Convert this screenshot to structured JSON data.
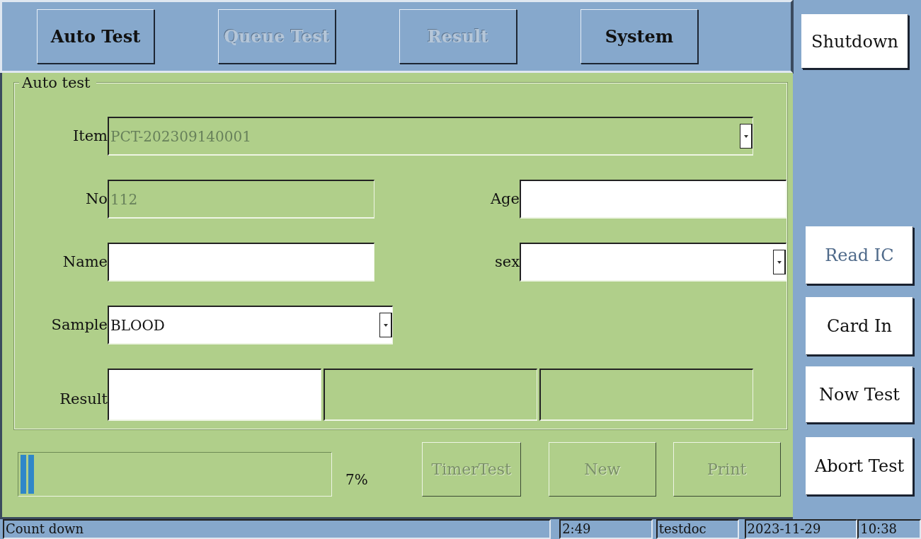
{
  "tabs": [
    {
      "label": "Auto Test",
      "disabled": false
    },
    {
      "label": "Queue Test",
      "disabled": true
    },
    {
      "label": "Result",
      "disabled": true
    },
    {
      "label": "System",
      "disabled": false
    }
  ],
  "side_buttons": [
    {
      "label": "Shutdown",
      "disabled": false
    },
    {
      "label": "Read IC",
      "disabled": true
    },
    {
      "label": "Card In",
      "disabled": false
    },
    {
      "label": "Now Test",
      "disabled": false
    },
    {
      "label": "Abort Test",
      "disabled": false
    }
  ],
  "group_title": "Auto test",
  "form_rows": [
    [
      {
        "label": "Item",
        "kind": "dropdown",
        "value": "PCT-202309140001",
        "disabled": true
      }
    ],
    [
      {
        "label": "No",
        "kind": "text",
        "value": "112",
        "disabled": true
      },
      {
        "label": "Age",
        "kind": "text",
        "disabled": false
      }
    ],
    [
      {
        "label": "Name",
        "kind": "text",
        "disabled": false
      },
      {
        "label": "sex",
        "kind": "dropdown",
        "disabled": false
      }
    ],
    [
      {
        "label": "Sample",
        "kind": "dropdown",
        "value": "BLOOD",
        "disabled": false
      }
    ]
  ],
  "result": {
    "label": "Result",
    "boxes": [
      {
        "disabled": false
      },
      {
        "disabled": true
      },
      {
        "disabled": true
      }
    ]
  },
  "progress": {
    "level": 0.05,
    "reading": "7%"
  },
  "bottom_buttons": [
    {
      "label": "TimerTest",
      "disabled": true
    },
    {
      "label": "New",
      "disabled": true
    },
    {
      "label": "Print",
      "disabled": true
    }
  ],
  "status_bar": [
    "Count down",
    "2:49",
    "testdoc",
    "2023-11-29",
    "10:38"
  ]
}
